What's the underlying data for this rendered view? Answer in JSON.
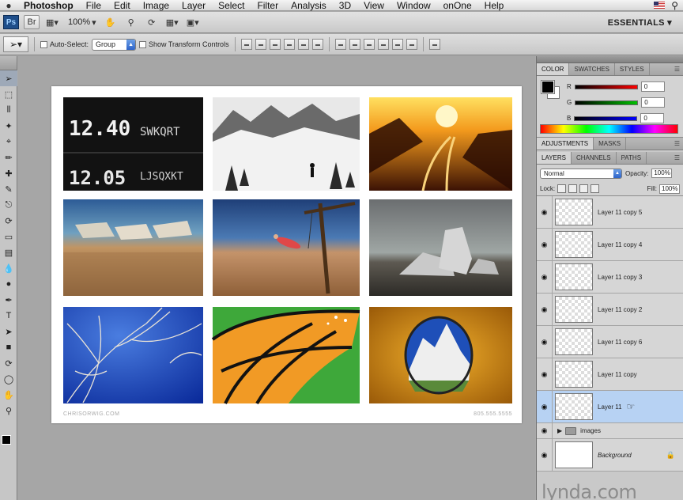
{
  "menubar": {
    "apple_icon": "apple-icon",
    "items": [
      "Photoshop",
      "File",
      "Edit",
      "Image",
      "Layer",
      "Select",
      "Filter",
      "Analysis",
      "3D",
      "View",
      "Window",
      "onOne",
      "Help"
    ]
  },
  "appbar": {
    "logo": "Ps",
    "zoom": "100%",
    "workspace": "ESSENTIALS ▾"
  },
  "options": {
    "auto_select": "Auto-Select:",
    "auto_select_value": "Group",
    "show_transform": "Show Transform Controls"
  },
  "color_panel": {
    "tabs": [
      "COLOR",
      "SWATCHES",
      "STYLES"
    ],
    "rows": [
      {
        "label": "R",
        "value": "0",
        "color": "#ff0000"
      },
      {
        "label": "G",
        "value": "0",
        "color": "#00c000"
      },
      {
        "label": "B",
        "value": "0",
        "color": "#0000ff"
      }
    ]
  },
  "adjustments": {
    "tabs": [
      "ADJUSTMENTS",
      "MASKS"
    ]
  },
  "layers_panel": {
    "tabs": [
      "LAYERS",
      "CHANNELS",
      "PATHS"
    ],
    "blend_mode": "Normal",
    "opacity_label": "Opacity:",
    "opacity_value": "100%",
    "lock_label": "Lock:",
    "fill_label": "Fill:",
    "fill_value": "100%",
    "layers": [
      "Layer 11 copy 5",
      "Layer 11 copy 4",
      "Layer 11 copy 3",
      "Layer 11 copy 2",
      "Layer 11 copy 6",
      "Layer 11 copy",
      "Layer 11"
    ],
    "group": "images",
    "background": "Background"
  },
  "document": {
    "footer_left": "CHRISORWIG.COM",
    "footer_right": "805.555.5555",
    "photos": [
      "scoreboard",
      "snow-hiker",
      "sunset-railroad",
      "beached-boats",
      "beach-swing",
      "beach-rocks",
      "bare-tree-sky",
      "monarch-butterfly",
      "tent-mountain-view"
    ]
  },
  "watermark": "lynda.com"
}
